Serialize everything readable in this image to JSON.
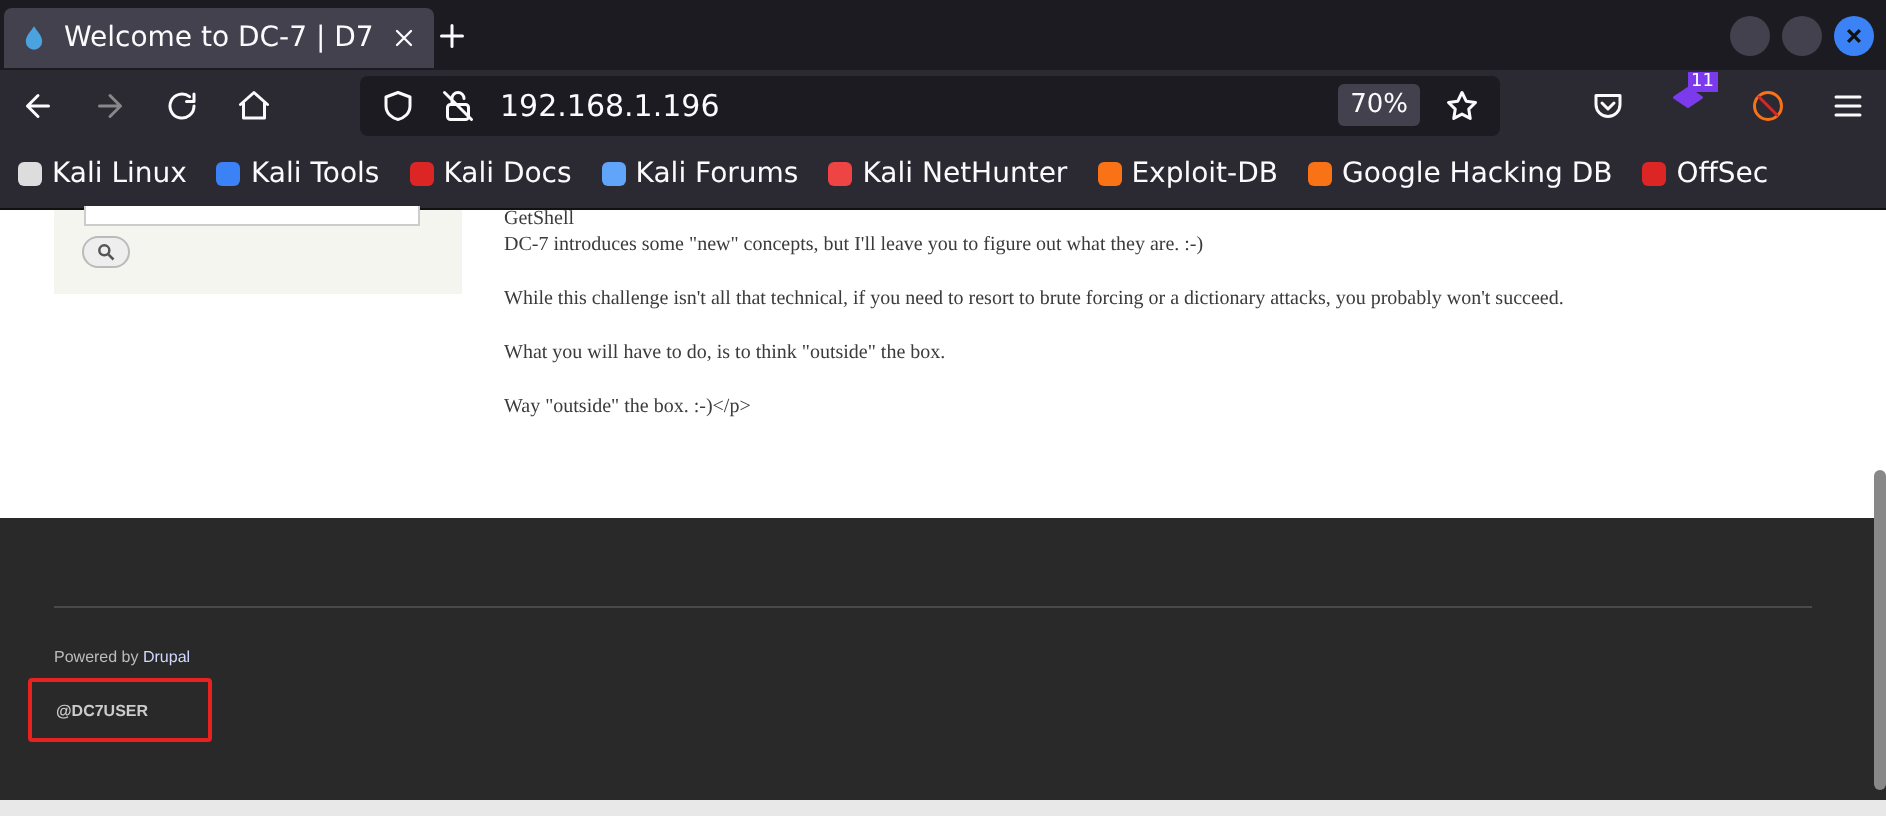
{
  "tab": {
    "title": "Welcome to DC-7 | D7",
    "selected": true
  },
  "address_bar": {
    "url": "192.168.1.196",
    "zoom": "70%"
  },
  "extension_badge": "11",
  "bookmarks": [
    {
      "label": "Kali Linux",
      "color": "#dddddd"
    },
    {
      "label": "Kali Tools",
      "color": "#3b82f6"
    },
    {
      "label": "Kali Docs",
      "color": "#dc2626"
    },
    {
      "label": "Kali Forums",
      "color": "#60a5fa"
    },
    {
      "label": "Kali NetHunter",
      "color": "#ef4444"
    },
    {
      "label": "Exploit-DB",
      "color": "#f97316"
    },
    {
      "label": "Google Hacking DB",
      "color": "#f97316"
    },
    {
      "label": "OffSec",
      "color": "#dc2626"
    }
  ],
  "content": {
    "heading": "GetShell",
    "paragraphs": [
      "DC-7 introduces some \"new\" concepts, but I'll leave you to figure out what they are.  :-)",
      "While this challenge isn't all that technical, if you need to resort to brute forcing or a dictionary attacks, you probably won't succeed.",
      "What you will have to do, is to think \"outside\" the box.",
      "Way \"outside\" the box.  :-)</p>"
    ]
  },
  "footer": {
    "powered_by": "Powered by",
    "powered_link": "Drupal",
    "user": "@DC7USER",
    "highlighted": true
  }
}
